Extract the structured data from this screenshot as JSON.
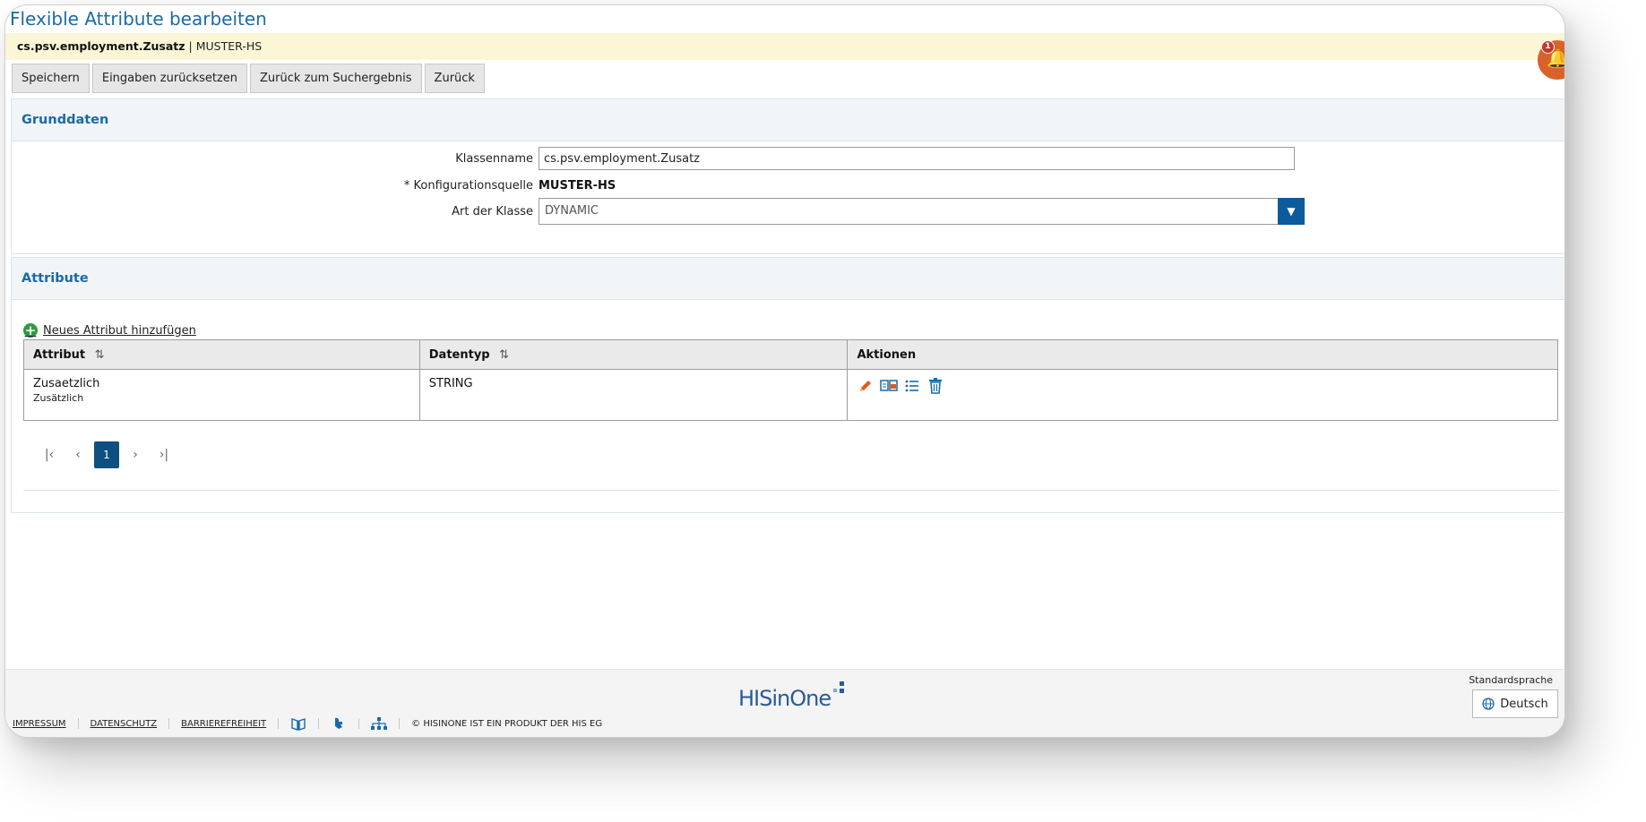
{
  "page": {
    "title": "Flexible Attribute bearbeiten"
  },
  "infobar": {
    "object_name": "cs.psv.employment.Zusatz",
    "separator": "|",
    "source": "MUSTER-HS"
  },
  "notification": {
    "count": "1"
  },
  "toolbar": {
    "save": "Speichern",
    "reset": "Eingaben zurücksetzen",
    "back_to_results": "Zurück zum Suchergebnis",
    "back": "Zurück"
  },
  "grunddaten": {
    "heading": "Grunddaten",
    "klassenname_label": "Klassenname",
    "klassenname_value": "cs.psv.employment.Zusatz",
    "konfig_label": "* Konfigurationsquelle",
    "konfig_value": "MUSTER-HS",
    "art_label": "Art der Klasse",
    "art_value": "DYNAMIC"
  },
  "attribute": {
    "heading": "Attribute",
    "add_label": "Neues Attribut hinzufügen",
    "columns": [
      "Attribut",
      "Datentyp",
      "Aktionen"
    ],
    "rows": [
      {
        "name": "Zusaetzlich",
        "subname": "Zusätzlich",
        "type": "STRING"
      }
    ],
    "pager": {
      "current": "1"
    }
  },
  "footer": {
    "links": [
      "IMPRESSUM",
      "DATENSCHUTZ",
      "BARRIEREFREIHEIT"
    ],
    "copyright": "© HISINONE IST EIN PRODUKT DER HIS EG",
    "logo_text": "HISinOne",
    "language_label": "Standardsprache",
    "language_value": "Deutsch"
  },
  "colors": {
    "accent": "#1a6aa8",
    "dark_blue": "#0d5a9c",
    "infobar": "#fbf6d6",
    "notification": "#d9622b",
    "edit_icon": "#e05a1a",
    "add_icon": "#2e9b3e"
  }
}
